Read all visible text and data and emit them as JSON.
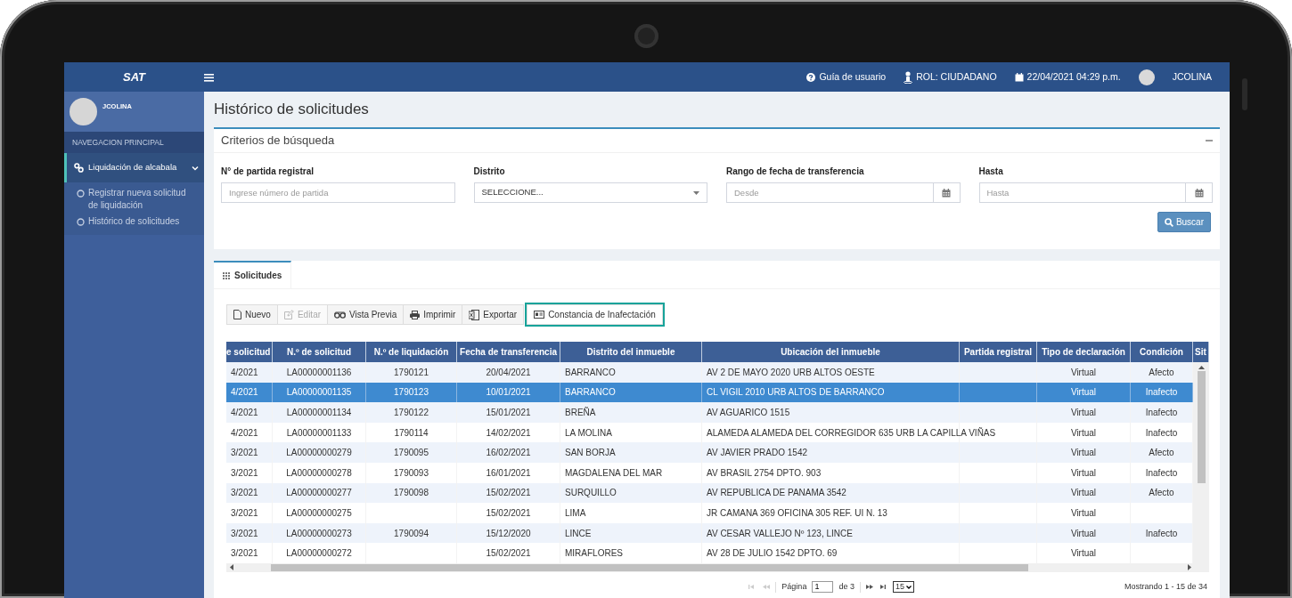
{
  "brand": "SAT",
  "topbar": {
    "items": [
      {
        "kind": "help",
        "label": "Guía de usuario"
      },
      {
        "kind": "role",
        "label": "ROL: CIUDADANO"
      },
      {
        "kind": "date",
        "label": "22/04/2021 04:29 p.m."
      },
      {
        "kind": "user",
        "label": "JCOLINA"
      }
    ]
  },
  "sidebar": {
    "user": "JCOLINA",
    "header": "NAVEGACION PRINCIPAL",
    "items": [
      {
        "label": "Liquidación de alcabala",
        "selected": true,
        "expanded": true,
        "children": [
          {
            "label": "Registrar nueva solicitud de liquidación",
            "selected": false
          },
          {
            "label": "Histórico de solicitudes",
            "selected": false
          }
        ]
      }
    ]
  },
  "page_title": "Histórico de solicitudes",
  "search": {
    "title": "Criterios de búsqueda",
    "fields": [
      {
        "kind": "text",
        "label": "N° de partida registral",
        "placeholder": "Ingrese número de partida"
      },
      {
        "kind": "select",
        "label": "Distrito",
        "value": "SELECCIONE..."
      },
      {
        "kind": "date",
        "label": "Rango de fecha de transferencia",
        "placeholder": "Desde"
      },
      {
        "kind": "date",
        "label": "Hasta",
        "placeholder": "Hasta"
      }
    ],
    "button": "Buscar"
  },
  "tabs": [
    {
      "label": "Solicitudes",
      "selected": true
    }
  ],
  "toolbar": [
    {
      "kind": "new",
      "label": "Nuevo",
      "disabled": false,
      "highlighted": false
    },
    {
      "kind": "edit",
      "label": "Editar",
      "disabled": true,
      "highlighted": false
    },
    {
      "kind": "preview",
      "label": "Vista Previa",
      "disabled": false,
      "highlighted": false
    },
    {
      "kind": "print",
      "label": "Imprimir",
      "disabled": false,
      "highlighted": false
    },
    {
      "kind": "export",
      "label": "Exportar",
      "disabled": false,
      "highlighted": false
    },
    {
      "kind": "certificate",
      "label": "Constancia de Inafectación",
      "disabled": false,
      "highlighted": true
    }
  ],
  "table": {
    "columns": [
      "e solicitud",
      "N.º de solicitud",
      "N.º de liquidación",
      "Fecha de transferencia",
      "Distrito del inmueble",
      "Ubicación del inmueble",
      "Partida registral",
      "Tipo de declaración",
      "Condición",
      "Sit"
    ],
    "rows": [
      {
        "selected": false,
        "cells": [
          "4/2021",
          "LA00000001136",
          "1790121",
          "20/04/2021",
          "BARRANCO",
          "AV 2 DE MAYO 2020 URB ALTOS OESTE",
          null,
          "Virtual",
          "Afecto"
        ]
      },
      {
        "selected": true,
        "cells": [
          "4/2021",
          "LA00000001135",
          "1790123",
          "10/01/2021",
          "BARRANCO",
          "CL VIGIL 2010 URB ALTOS DE BARRANCO",
          null,
          "Virtual",
          "Inafecto"
        ]
      },
      {
        "selected": false,
        "cells": [
          "4/2021",
          "LA00000001134",
          "1790122",
          "15/01/2021",
          "BREÑA",
          "AV AGUARICO 1515",
          null,
          "Virtual",
          "Inafecto"
        ]
      },
      {
        "selected": false,
        "cells": [
          "4/2021",
          "LA00000001133",
          "1790114",
          "14/02/2021",
          "LA MOLINA",
          "ALAMEDA ALAMEDA DEL CORREGIDOR 635 URB LA CAPILLA VIÑAS",
          null,
          "Virtual",
          "Inafecto"
        ]
      },
      {
        "selected": false,
        "cells": [
          "3/2021",
          "LA00000000279",
          "1790095",
          "16/02/2021",
          "SAN BORJA",
          "AV JAVIER PRADO 1542",
          null,
          "Virtual",
          "Afecto"
        ]
      },
      {
        "selected": false,
        "cells": [
          "3/2021",
          "LA00000000278",
          "1790093",
          "16/01/2021",
          "MAGDALENA DEL MAR",
          "AV BRASIL 2754 DPTO. 903",
          null,
          "Virtual",
          "Inafecto"
        ]
      },
      {
        "selected": false,
        "cells": [
          "3/2021",
          "LA00000000277",
          "1790098",
          "15/02/2021",
          "SURQUILLO",
          "AV REPUBLICA DE PANAMA 3542",
          null,
          "Virtual",
          "Afecto"
        ]
      },
      {
        "selected": false,
        "cells": [
          "3/2021",
          "LA00000000275",
          null,
          "15/02/2021",
          "LIMA",
          "JR CAMANA 369 OFICINA 305 REF. UI N. 13",
          null,
          "Virtual",
          null
        ]
      },
      {
        "selected": false,
        "cells": [
          "3/2021",
          "LA00000000273",
          "1790094",
          "15/12/2020",
          "LINCE",
          "AV CESAR VALLEJO Nº 123, LINCE",
          null,
          "Virtual",
          "Inafecto"
        ]
      },
      {
        "selected": false,
        "cells": [
          "3/2021",
          "LA00000000272",
          null,
          "15/02/2021",
          "MIRAFLORES",
          "AV 28 DE JULIO 1542 DPTO. 69",
          null,
          "Virtual",
          null
        ]
      }
    ]
  },
  "pager": {
    "buttons": [
      {
        "kind": "first",
        "disabled": true
      },
      {
        "kind": "prev",
        "disabled": true
      },
      {
        "kind": "next",
        "disabled": false
      },
      {
        "kind": "last",
        "disabled": false
      }
    ],
    "page_label": "Página",
    "page": "1",
    "of": "de 3",
    "page_size": "15",
    "summary": "Mostrando 1 - 15 de 34"
  }
}
